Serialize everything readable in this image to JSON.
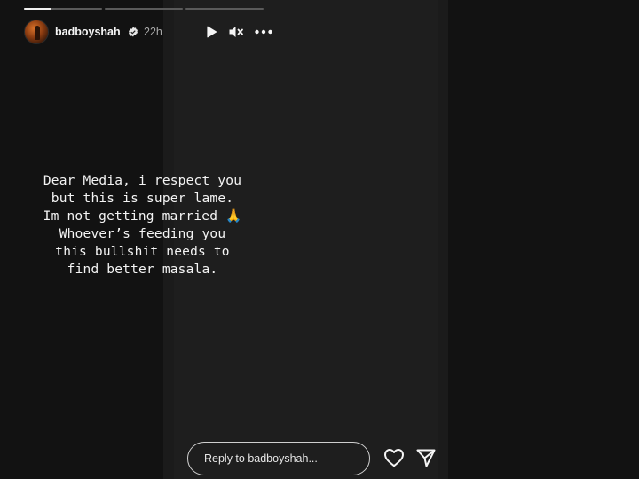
{
  "story": {
    "username": "badboyshah",
    "time": "22h",
    "progress": [
      1.0,
      0.0,
      0.0
    ],
    "progress_partial": 0.35,
    "caption": "Dear Media, i respect you\nbut this is super lame.\nIm not getting married 🙏\nWhoever’s feeding you\nthis bullshit needs to\nfind better masala."
  },
  "reply": {
    "placeholder": "Reply to badboyshah..."
  },
  "icons": {
    "play": "play-icon",
    "mute": "muted-speaker-icon",
    "more": "more-icon",
    "verified": "verified-badge-icon",
    "like": "heart-icon",
    "share": "send-icon"
  },
  "colors": {
    "background": "#131313",
    "story_background": "#1e1e1e",
    "text": "#f4f4f4",
    "verified": "#3897f0"
  }
}
